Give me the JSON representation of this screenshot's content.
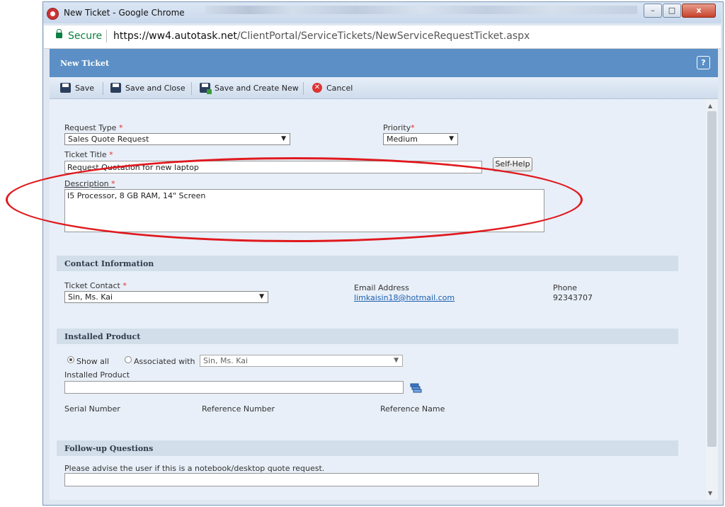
{
  "browser": {
    "window_title": "New Ticket - Google Chrome",
    "secure_label": "Secure",
    "url_host": "https://ww4.autotask.net",
    "url_path": "/ClientPortal/ServiceTickets/NewServiceRequestTicket.aspx",
    "minimize": "–",
    "maximize": "□",
    "close": "x"
  },
  "header": {
    "title": "New Ticket",
    "help": "?"
  },
  "toolbar": {
    "save": "Save",
    "save_close": "Save and Close",
    "save_create_new": "Save and Create New",
    "cancel": "Cancel"
  },
  "form": {
    "request_type_label": "Request Type",
    "request_type_value": "Sales Quote Request",
    "priority_label": "Priority",
    "priority_value": "Medium",
    "ticket_title_label": "Ticket Title",
    "ticket_title_value": "Request Quotation for new laptop",
    "self_help": "Self-Help",
    "description_label": "Description",
    "description_value": "I5 Processor, 8 GB RAM, 14\" Screen",
    "required_mark": "*"
  },
  "contact": {
    "section_title": "Contact Information",
    "ticket_contact_label": "Ticket Contact",
    "ticket_contact_value": "Sin, Ms. Kai",
    "email_label": "Email Address",
    "email_value": "limkaisin18@hotmail.com",
    "phone_label": "Phone",
    "phone_value": "92343707"
  },
  "installed_product": {
    "section_title": "Installed Product",
    "show_all": "Show all",
    "associated_with": "Associated with",
    "associated_value": "Sin, Ms. Kai",
    "product_label": "Installed Product",
    "serial_label": "Serial Number",
    "reference_number_label": "Reference Number",
    "reference_name_label": "Reference Name"
  },
  "followup": {
    "section_title": "Follow-up Questions",
    "question_1": "Please advise the user if this is a notebook/desktop quote request."
  },
  "scrollbar": {
    "up": "▲",
    "down": "▼"
  },
  "colors": {
    "header_blue": "#5b8fc5",
    "callout_red": "#e0191e",
    "link_blue": "#1d5fb0"
  }
}
